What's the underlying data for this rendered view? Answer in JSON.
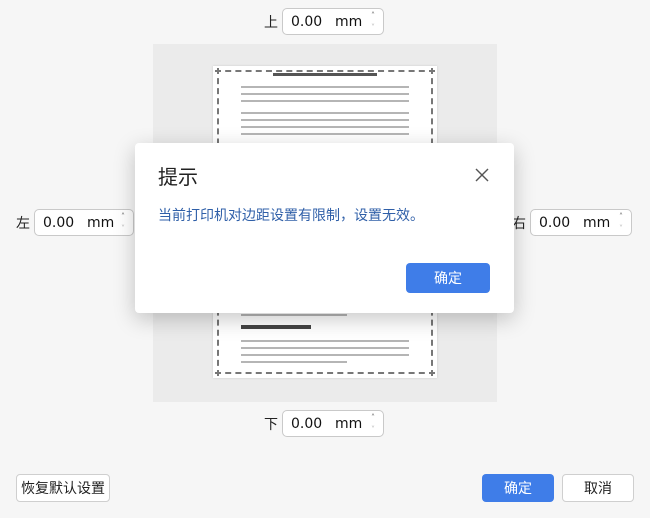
{
  "margins": {
    "top": {
      "label": "上",
      "value": "0.00",
      "unit": "mm"
    },
    "bottom": {
      "label": "下",
      "value": "0.00",
      "unit": "mm"
    },
    "left": {
      "label": "左",
      "value": "0.00",
      "unit": "mm"
    },
    "right": {
      "label": "右",
      "value": "0.00",
      "unit": "mm"
    }
  },
  "dialog": {
    "title": "提示",
    "message": "当前打印机对边距设置有限制，设置无效。",
    "ok_label": "确定"
  },
  "footer": {
    "reset_label": "恢复默认设置",
    "ok_label": "确定",
    "cancel_label": "取消"
  },
  "colors": {
    "primary": "#3f7de8",
    "message_text": "#2f5fa8"
  },
  "icons": {
    "spin_up": "chevron-up-icon",
    "spin_down": "chevron-down-icon",
    "close": "close-icon"
  }
}
